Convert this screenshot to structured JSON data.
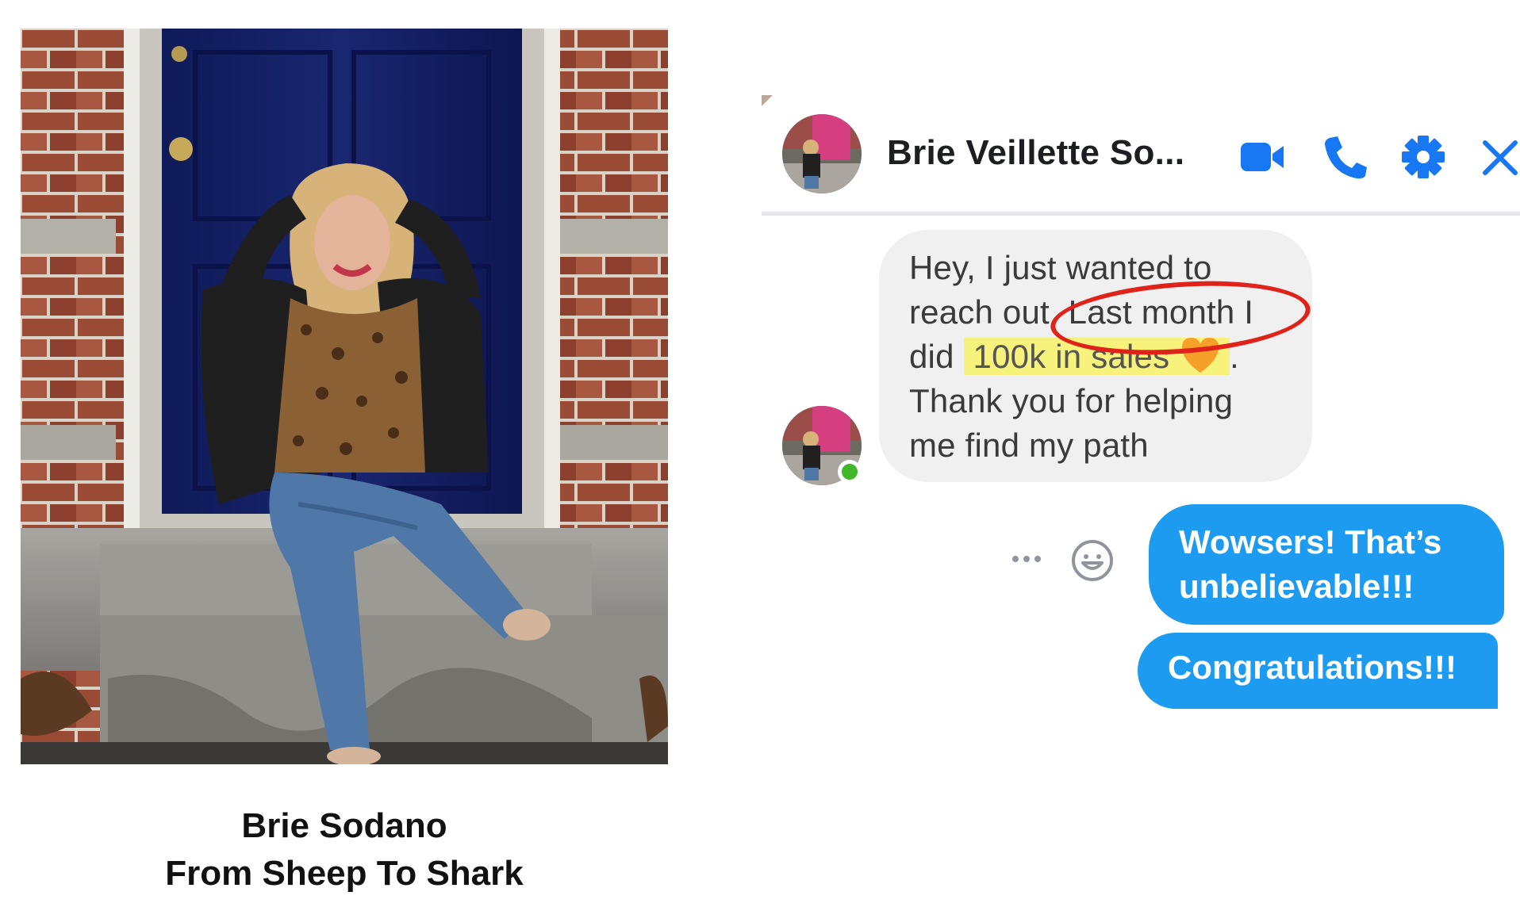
{
  "photo": {
    "caption_line1": "Brie Sodano",
    "caption_line2": "From Sheep To Shark"
  },
  "chat": {
    "contact_name": "Brie Veillette So...",
    "header_icons": [
      "video-camera-icon",
      "phone-icon",
      "gear-icon",
      "close-icon"
    ],
    "contact_status": "online",
    "received_message": {
      "line1": "Hey, I just wanted to",
      "line2": "reach out. Last month I",
      "line3_prefix": "did",
      "line3_highlight": "100k in sales",
      "line3_suffix": ".",
      "line4": "Thank you for helping",
      "line5": "me find my path",
      "emoji": "orange-heart"
    },
    "sent_messages": {
      "first_line1": "Wowsers! That’s",
      "first_line2": "unbelievable!!!",
      "second": "Congratulations!!!"
    },
    "message_actions": [
      "more-options-icon",
      "emoji-reaction-icon"
    ]
  },
  "colors": {
    "sent_bubble": "#1d9bf0",
    "received_bubble": "#f0f0f0",
    "highlight": "#f6f27c",
    "annotation_circle": "#e0231a",
    "icon_blue": "#1877f2",
    "online_dot": "#42b72a"
  }
}
